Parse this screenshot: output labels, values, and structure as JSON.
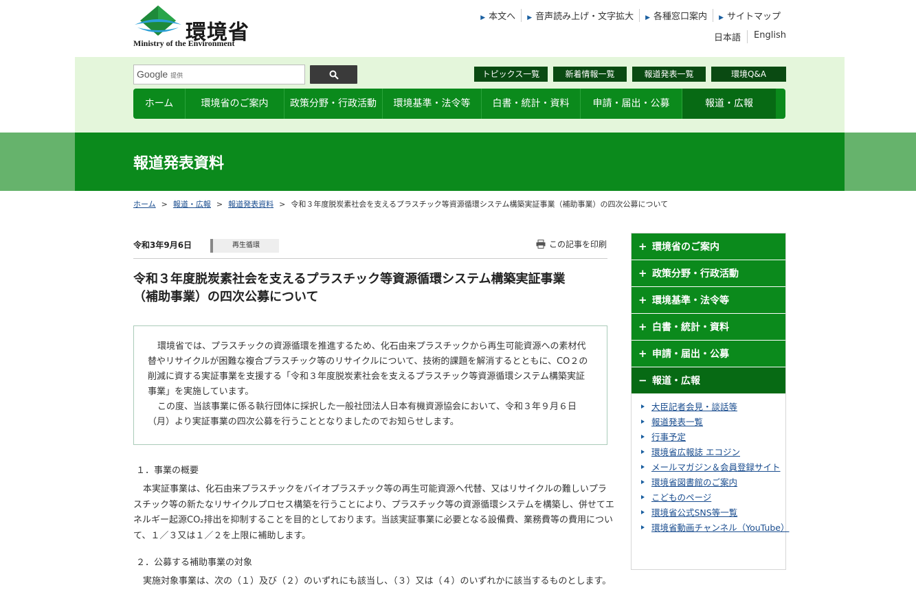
{
  "header": {
    "logo_jp": "環境省",
    "logo_en": "Ministry of the Environment",
    "util_links": [
      "本文へ",
      "音声読み上げ・文字拡大",
      "各種窓口案内",
      "サイトマップ"
    ],
    "languages": [
      "日本語",
      "English"
    ]
  },
  "search": {
    "google": "Google",
    "provided": "提供"
  },
  "quick_links": [
    "トピックス一覧",
    "新着情報一覧",
    "報道発表一覧",
    "環境Q&A"
  ],
  "global_nav": [
    "ホーム",
    "環境省のご案内",
    "政策分野・行政活動",
    "環境基準・法令等",
    "白書・統計・資料",
    "申請・届出・公募",
    "報道・広報"
  ],
  "page_heading": "報道発表資料",
  "breadcrumb": {
    "items": [
      "ホーム",
      "報道・広報",
      "報道発表資料"
    ],
    "current": "令和３年度脱炭素社会を支えるプラスチック等資源循環システム構築実証事業（補助事業）の四次公募について",
    "separator": ">"
  },
  "article": {
    "date": "令和3年9月6日",
    "tag": "再生循環",
    "print_label": "この記事を印刷",
    "title_line1": "令和３年度脱炭素社会を支えるプラスチック等資源循環システム構築実証事業",
    "title_line2": "（補助事業）の四次公募について",
    "summary_p1": "環境省では、プラスチックの資源循環を推進するため、化石由来プラスチックから再生可能資源への素材代替やリサイクルが困難な複合プラスチック等のリサイクルについて、技術的課題を解消するとともに、CO２の削減に資する実証事業を支援する「令和３年度脱炭素社会を支えるプラスチック等資源循環システム構築実証事業」を実施しています。",
    "summary_p2": "この度、当該事業に係る執行団体に採択した一般社団法人日本有機資源協会において、令和３年９月６日（月）より実証事業の四次公募を行うこととなりましたのでお知らせします。",
    "section1_heading": "１．事業の概要",
    "section1_body": "本実証事業は、化石由来プラスチックをバイオプラスチック等の再生可能資源へ代替、又はリサイクルの難しいプラスチック等の新たなリサイクルプロセス構築を行うことにより、プラスチック等の資源循環システムを構築し、併せてエネルギー起源CO₂排出を抑制することを目的としております。当該実証事業に必要となる設備費、業務費等の費用について、１／３又は１／２を上限に補助します。",
    "section2_heading": "２．公募する補助事業の対象",
    "section2_body": "実施対象事業は、次の（１）及び（２）のいずれにも該当し、（３）又は（４）のいずれかに該当するものとします。"
  },
  "sidebar": {
    "categories": [
      {
        "label": "環境省のご案内",
        "sign": "+"
      },
      {
        "label": "政策分野・行政活動",
        "sign": "+"
      },
      {
        "label": "環境基準・法令等",
        "sign": "+"
      },
      {
        "label": "白書・統計・資料",
        "sign": "+"
      },
      {
        "label": "申請・届出・公募",
        "sign": "+"
      },
      {
        "label": "報道・広報",
        "sign": "−"
      }
    ],
    "links": [
      "大臣記者会見・談話等",
      "報道発表一覧",
      "行事予定",
      "環境省広報誌 エコジン",
      "メールマガジン＆会員登録サイト",
      "環境省図書館のご案内",
      "こどものページ",
      "環境省公式SNS等一覧",
      "環境省動画チャンネル（YouTube）"
    ]
  }
}
